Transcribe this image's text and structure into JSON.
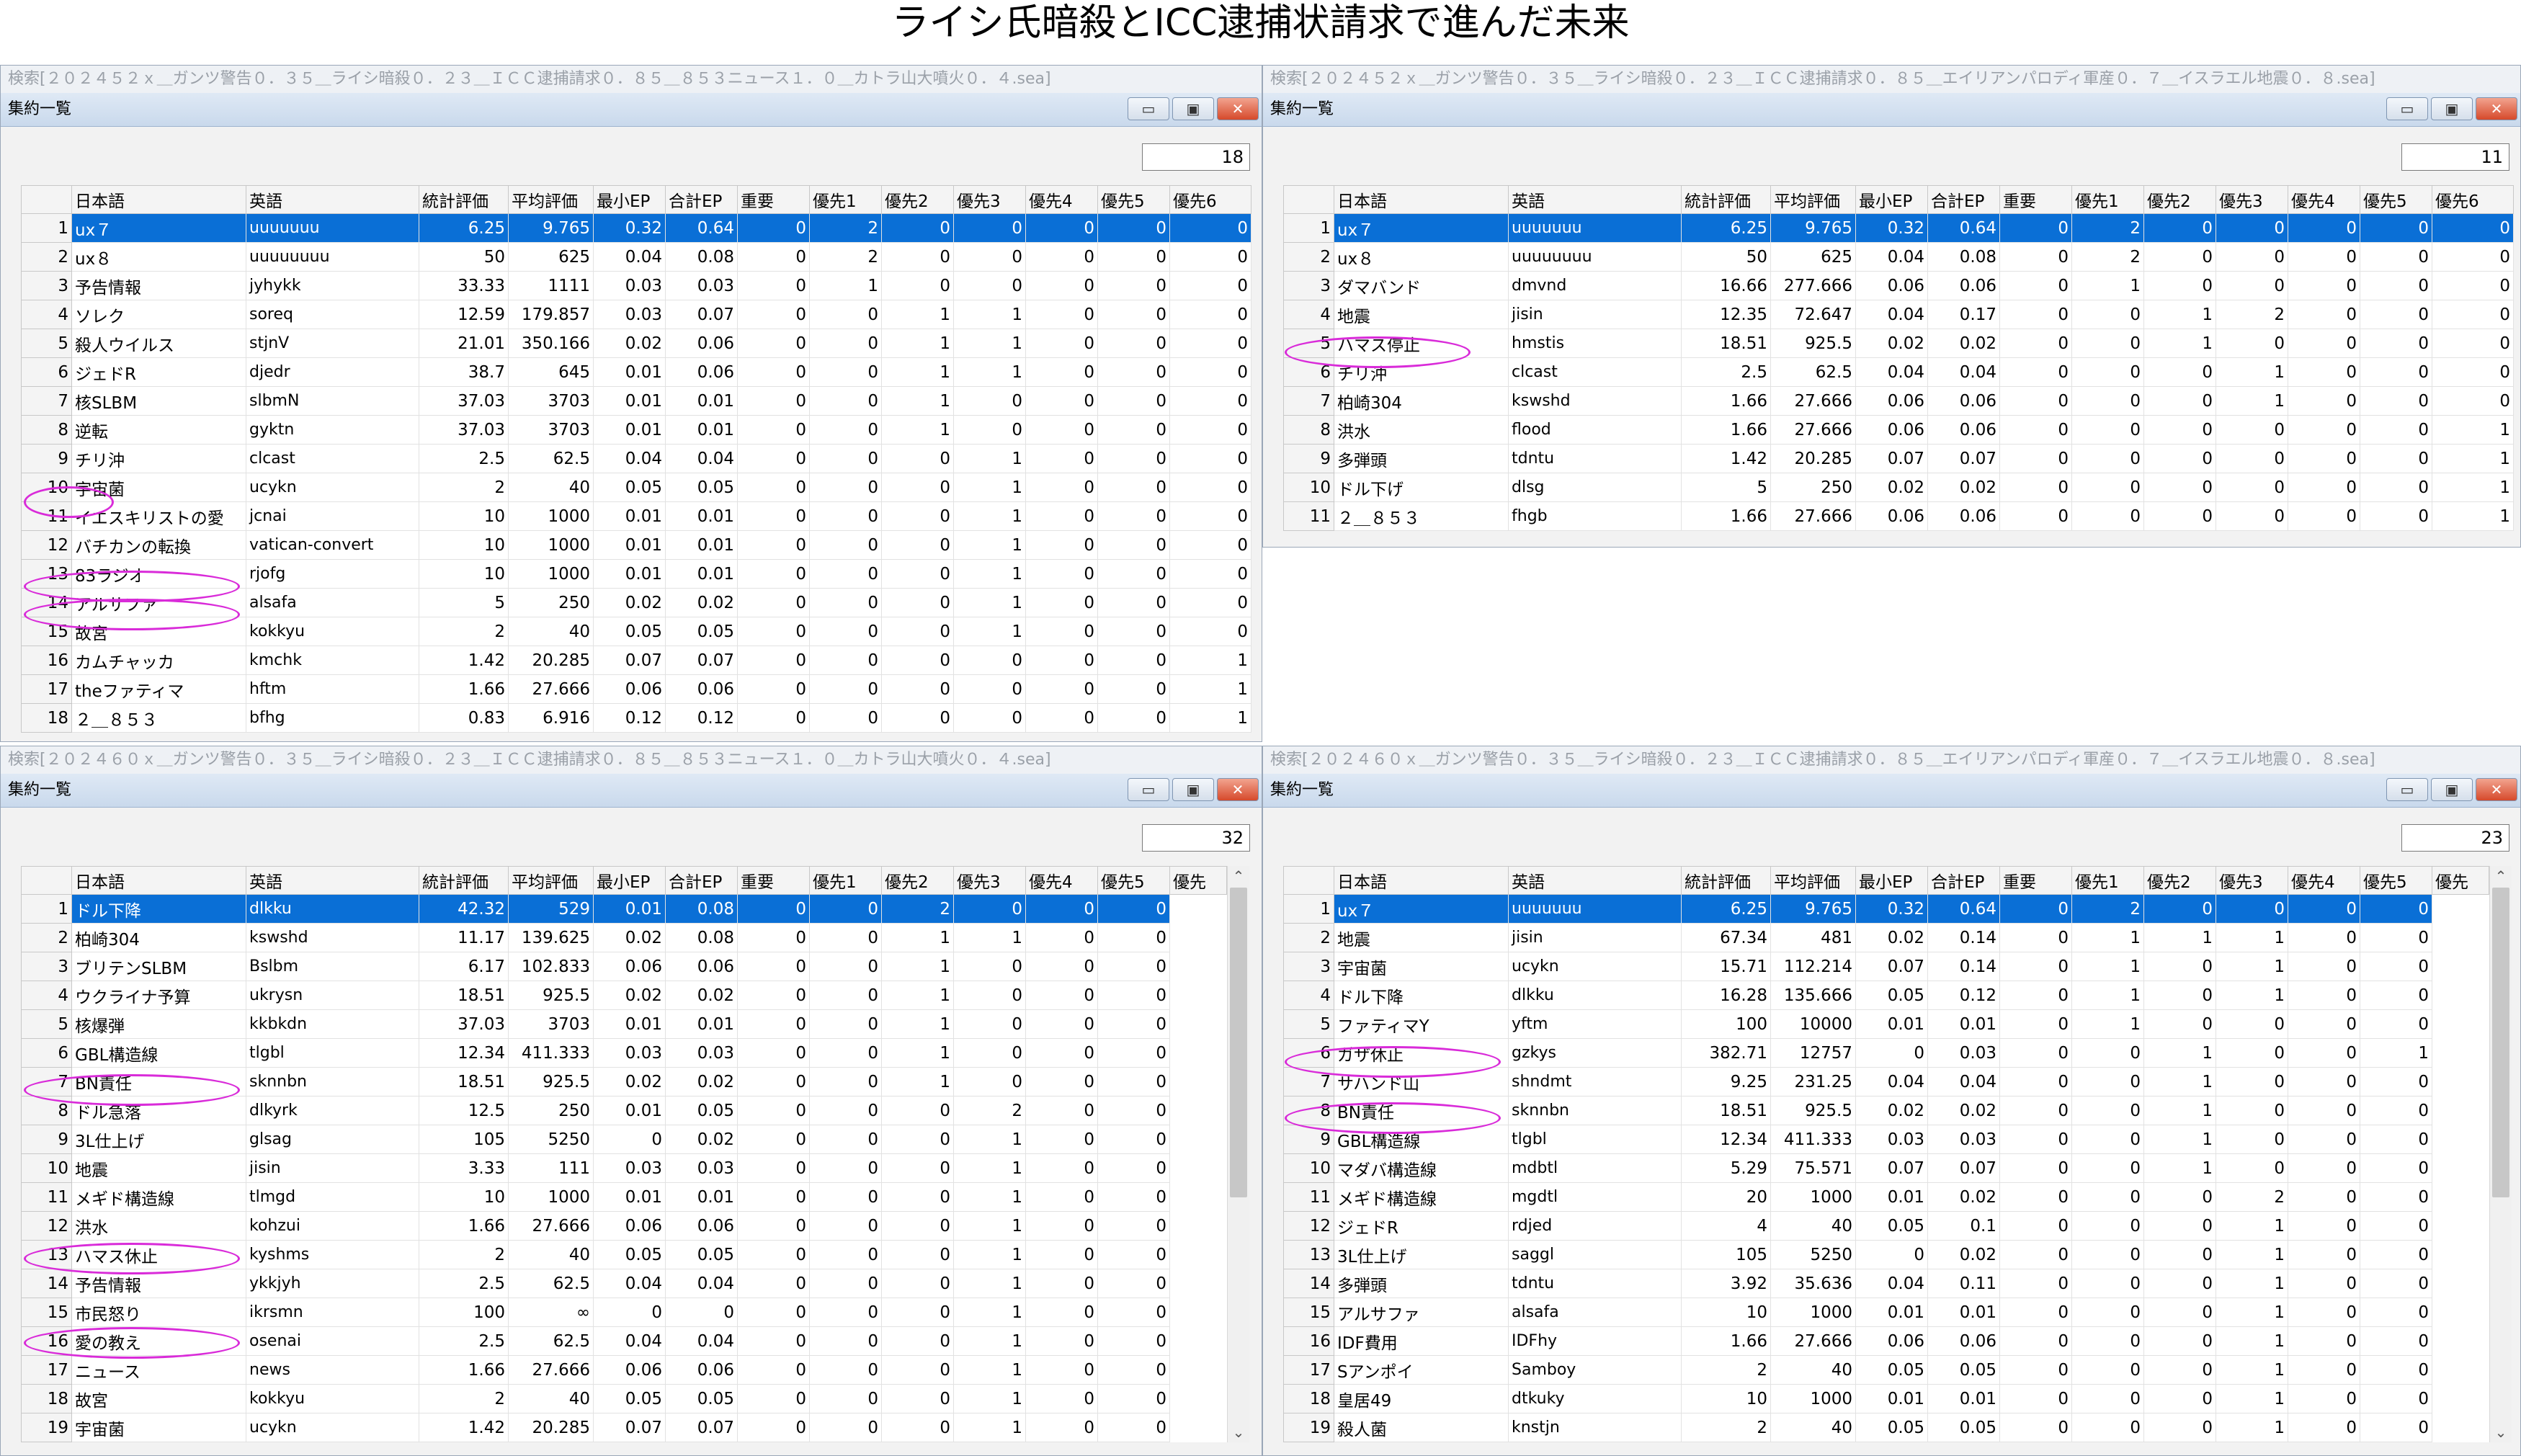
{
  "title": "ライシ氏暗殺とICC逮捕状請求で進んだ未来",
  "panels": [
    {
      "search": "検索[２０２４５２ｘ＿ガンツ警告０．３５＿ライシ暗殺０．２３＿ＩＣＣ逮捕請求０．８５＿８５３ニュース１．０＿カトラ山大噴火０．４.sea]",
      "window_title": "集約一覧",
      "count": "18",
      "headers": [
        "日本語",
        "英語",
        "統計評価",
        "平均評価",
        "最小EP",
        "合計EP",
        "重要",
        "優先1",
        "優先2",
        "優先3",
        "優先4",
        "優先5",
        "優先6"
      ],
      "rows": [
        [
          "1",
          "ux７",
          "uuuuuuu",
          "6.25",
          "9.765",
          "0.32",
          "0.64",
          "0",
          "2",
          "0",
          "0",
          "0",
          "0",
          "0"
        ],
        [
          "2",
          "ux８",
          "uuuuuuuu",
          "50",
          "625",
          "0.04",
          "0.08",
          "0",
          "2",
          "0",
          "0",
          "0",
          "0",
          "0"
        ],
        [
          "3",
          "予告情報",
          "jyhykk",
          "33.33",
          "1111",
          "0.03",
          "0.03",
          "0",
          "1",
          "0",
          "0",
          "0",
          "0",
          "0"
        ],
        [
          "4",
          "ソレク",
          "soreq",
          "12.59",
          "179.857",
          "0.03",
          "0.07",
          "0",
          "0",
          "1",
          "1",
          "0",
          "0",
          "0"
        ],
        [
          "5",
          "殺人ウイルス",
          "stjnV",
          "21.01",
          "350.166",
          "0.02",
          "0.06",
          "0",
          "0",
          "1",
          "1",
          "0",
          "0",
          "0"
        ],
        [
          "6",
          "ジェドR",
          "djedr",
          "38.7",
          "645",
          "0.01",
          "0.06",
          "0",
          "0",
          "1",
          "1",
          "0",
          "0",
          "0"
        ],
        [
          "7",
          "核SLBM",
          "slbmN",
          "37.03",
          "3703",
          "0.01",
          "0.01",
          "0",
          "0",
          "1",
          "0",
          "0",
          "0",
          "0"
        ],
        [
          "8",
          "逆転",
          "gyktn",
          "37.03",
          "3703",
          "0.01",
          "0.01",
          "0",
          "0",
          "1",
          "0",
          "0",
          "0",
          "0"
        ],
        [
          "9",
          "チリ沖",
          "clcast",
          "2.5",
          "62.5",
          "0.04",
          "0.04",
          "0",
          "0",
          "0",
          "1",
          "0",
          "0",
          "0"
        ],
        [
          "10",
          "宇宙菌",
          "ucykn",
          "2",
          "40",
          "0.05",
          "0.05",
          "0",
          "0",
          "0",
          "1",
          "0",
          "0",
          "0"
        ],
        [
          "11",
          "イエスキリストの愛",
          "jcnai",
          "10",
          "1000",
          "0.01",
          "0.01",
          "0",
          "0",
          "0",
          "1",
          "0",
          "0",
          "0"
        ],
        [
          "12",
          "バチカンの転換",
          "vatican-convert",
          "10",
          "1000",
          "0.01",
          "0.01",
          "0",
          "0",
          "0",
          "1",
          "0",
          "0",
          "0"
        ],
        [
          "13",
          "83ラジオ",
          "rjofg",
          "10",
          "1000",
          "0.01",
          "0.01",
          "0",
          "0",
          "0",
          "1",
          "0",
          "0",
          "0"
        ],
        [
          "14",
          "アルサファ",
          "alsafa",
          "5",
          "250",
          "0.02",
          "0.02",
          "0",
          "0",
          "0",
          "1",
          "0",
          "0",
          "0"
        ],
        [
          "15",
          "故宮",
          "kokkyu",
          "2",
          "40",
          "0.05",
          "0.05",
          "0",
          "0",
          "0",
          "1",
          "0",
          "0",
          "0"
        ],
        [
          "16",
          "カムチャッカ",
          "kmchk",
          "1.42",
          "20.285",
          "0.07",
          "0.07",
          "0",
          "0",
          "0",
          "0",
          "0",
          "0",
          "1"
        ],
        [
          "17",
          "theファティマ",
          "hftm",
          "1.66",
          "27.666",
          "0.06",
          "0.06",
          "0",
          "0",
          "0",
          "0",
          "0",
          "0",
          "1"
        ],
        [
          "18",
          "２＿８５３",
          "bfhg",
          "0.83",
          "6.916",
          "0.12",
          "0.12",
          "0",
          "0",
          "0",
          "0",
          "0",
          "0",
          "1"
        ]
      ]
    },
    {
      "search": "検索[２０２４５２ｘ＿ガンツ警告０．３５＿ライシ暗殺０．２３＿ＩＣＣ逮捕請求０．８５＿エイリアンパロディ軍産０．７＿イスラエル地震０．８.sea]",
      "window_title": "集約一覧",
      "count": "11",
      "headers": [
        "日本語",
        "英語",
        "統計評価",
        "平均評価",
        "最小EP",
        "合計EP",
        "重要",
        "優先1",
        "優先2",
        "優先3",
        "優先4",
        "優先5",
        "優先6"
      ],
      "rows": [
        [
          "1",
          "ux７",
          "uuuuuuu",
          "6.25",
          "9.765",
          "0.32",
          "0.64",
          "0",
          "2",
          "0",
          "0",
          "0",
          "0",
          "0"
        ],
        [
          "2",
          "ux８",
          "uuuuuuuu",
          "50",
          "625",
          "0.04",
          "0.08",
          "0",
          "2",
          "0",
          "0",
          "0",
          "0",
          "0"
        ],
        [
          "3",
          "ダマバンド",
          "dmvnd",
          "16.66",
          "277.666",
          "0.06",
          "0.06",
          "0",
          "1",
          "0",
          "0",
          "0",
          "0",
          "0"
        ],
        [
          "4",
          "地震",
          "jisin",
          "12.35",
          "72.647",
          "0.04",
          "0.17",
          "0",
          "0",
          "1",
          "2",
          "0",
          "0",
          "0"
        ],
        [
          "5",
          "ハマス停止",
          "hmstis",
          "18.51",
          "925.5",
          "0.02",
          "0.02",
          "0",
          "0",
          "1",
          "0",
          "0",
          "0",
          "0"
        ],
        [
          "6",
          "チリ沖",
          "clcast",
          "2.5",
          "62.5",
          "0.04",
          "0.04",
          "0",
          "0",
          "0",
          "1",
          "0",
          "0",
          "0"
        ],
        [
          "7",
          "柏崎304",
          "kswshd",
          "1.66",
          "27.666",
          "0.06",
          "0.06",
          "0",
          "0",
          "0",
          "1",
          "0",
          "0",
          "0"
        ],
        [
          "8",
          "洪水",
          "flood",
          "1.66",
          "27.666",
          "0.06",
          "0.06",
          "0",
          "0",
          "0",
          "0",
          "0",
          "0",
          "1"
        ],
        [
          "9",
          "多弾頭",
          "tdntu",
          "1.42",
          "20.285",
          "0.07",
          "0.07",
          "0",
          "0",
          "0",
          "0",
          "0",
          "0",
          "1"
        ],
        [
          "10",
          "ドル下げ",
          "dlsg",
          "5",
          "250",
          "0.02",
          "0.02",
          "0",
          "0",
          "0",
          "0",
          "0",
          "0",
          "1"
        ],
        [
          "11",
          "２＿８５３",
          "fhgb",
          "1.66",
          "27.666",
          "0.06",
          "0.06",
          "0",
          "0",
          "0",
          "0",
          "0",
          "0",
          "1"
        ]
      ]
    },
    {
      "search": "検索[２０２４６０ｘ＿ガンツ警告０．３５＿ライシ暗殺０．２３＿ＩＣＣ逮捕請求０．８５＿８５３ニュース１．０＿カトラ山大噴火０．４.sea]",
      "window_title": "集約一覧",
      "count": "32",
      "headers": [
        "日本語",
        "英語",
        "統計評価",
        "平均評価",
        "最小EP",
        "合計EP",
        "重要",
        "優先1",
        "優先2",
        "優先3",
        "優先4",
        "優先5",
        "優先"
      ],
      "rows": [
        [
          "1",
          "ドル下降",
          "dlkku",
          "42.32",
          "529",
          "0.01",
          "0.08",
          "0",
          "0",
          "2",
          "0",
          "0",
          "0"
        ],
        [
          "2",
          "柏崎304",
          "kswshd",
          "11.17",
          "139.625",
          "0.02",
          "0.08",
          "0",
          "0",
          "1",
          "1",
          "0",
          "0"
        ],
        [
          "3",
          "ブリテンSLBM",
          "Bslbm",
          "6.17",
          "102.833",
          "0.06",
          "0.06",
          "0",
          "0",
          "1",
          "0",
          "0",
          "0"
        ],
        [
          "4",
          "ウクライナ予算",
          "ukrysn",
          "18.51",
          "925.5",
          "0.02",
          "0.02",
          "0",
          "0",
          "1",
          "0",
          "0",
          "0"
        ],
        [
          "5",
          "核爆弾",
          "kkbkdn",
          "37.03",
          "3703",
          "0.01",
          "0.01",
          "0",
          "0",
          "1",
          "0",
          "0",
          "0"
        ],
        [
          "6",
          "GBL構造線",
          "tlgbl",
          "12.34",
          "411.333",
          "0.03",
          "0.03",
          "0",
          "0",
          "1",
          "0",
          "0",
          "0"
        ],
        [
          "7",
          "BN責任",
          "sknnbn",
          "18.51",
          "925.5",
          "0.02",
          "0.02",
          "0",
          "0",
          "1",
          "0",
          "0",
          "0"
        ],
        [
          "8",
          "ドル急落",
          "dlkyrk",
          "12.5",
          "250",
          "0.01",
          "0.05",
          "0",
          "0",
          "0",
          "2",
          "0",
          "0"
        ],
        [
          "9",
          "3L仕上げ",
          "glsag",
          "105",
          "5250",
          "0",
          "0.02",
          "0",
          "0",
          "0",
          "1",
          "0",
          "0"
        ],
        [
          "10",
          "地震",
          "jisin",
          "3.33",
          "111",
          "0.03",
          "0.03",
          "0",
          "0",
          "0",
          "1",
          "0",
          "0"
        ],
        [
          "11",
          "メギド構造線",
          "tlmgd",
          "10",
          "1000",
          "0.01",
          "0.01",
          "0",
          "0",
          "0",
          "1",
          "0",
          "0"
        ],
        [
          "12",
          "洪水",
          "kohzui",
          "1.66",
          "27.666",
          "0.06",
          "0.06",
          "0",
          "0",
          "0",
          "1",
          "0",
          "0"
        ],
        [
          "13",
          "ハマス休止",
          "kyshms",
          "2",
          "40",
          "0.05",
          "0.05",
          "0",
          "0",
          "0",
          "1",
          "0",
          "0"
        ],
        [
          "14",
          "予告情報",
          "ykkjyh",
          "2.5",
          "62.5",
          "0.04",
          "0.04",
          "0",
          "0",
          "0",
          "1",
          "0",
          "0"
        ],
        [
          "15",
          "市民怒り",
          "ikrsmn",
          "100",
          "∞",
          "0",
          "0",
          "0",
          "0",
          "0",
          "1",
          "0",
          "0"
        ],
        [
          "16",
          "愛の教え",
          "osenai",
          "2.5",
          "62.5",
          "0.04",
          "0.04",
          "0",
          "0",
          "0",
          "1",
          "0",
          "0"
        ],
        [
          "17",
          "ニュース",
          "news",
          "1.66",
          "27.666",
          "0.06",
          "0.06",
          "0",
          "0",
          "0",
          "1",
          "0",
          "0"
        ],
        [
          "18",
          "故宮",
          "kokkyu",
          "2",
          "40",
          "0.05",
          "0.05",
          "0",
          "0",
          "0",
          "1",
          "0",
          "0"
        ],
        [
          "19",
          "宇宙菌",
          "ucykn",
          "1.42",
          "20.285",
          "0.07",
          "0.07",
          "0",
          "0",
          "0",
          "1",
          "0",
          "0"
        ]
      ]
    },
    {
      "search": "検索[２０２４６０ｘ＿ガンツ警告０．３５＿ライシ暗殺０．２３＿ＩＣＣ逮捕請求０．８５＿エイリアンパロディ軍産０．７＿イスラエル地震０．８.sea]",
      "window_title": "集約一覧",
      "count": "23",
      "headers": [
        "日本語",
        "英語",
        "統計評価",
        "平均評価",
        "最小EP",
        "合計EP",
        "重要",
        "優先1",
        "優先2",
        "優先3",
        "優先4",
        "優先5",
        "優先"
      ],
      "rows": [
        [
          "1",
          "ux７",
          "uuuuuuu",
          "6.25",
          "9.765",
          "0.32",
          "0.64",
          "0",
          "2",
          "0",
          "0",
          "0",
          "0"
        ],
        [
          "2",
          "地震",
          "jisin",
          "67.34",
          "481",
          "0.02",
          "0.14",
          "0",
          "1",
          "1",
          "1",
          "0",
          "0"
        ],
        [
          "3",
          "宇宙菌",
          "ucykn",
          "15.71",
          "112.214",
          "0.07",
          "0.14",
          "0",
          "1",
          "0",
          "1",
          "0",
          "0"
        ],
        [
          "4",
          "ドル下降",
          "dlkku",
          "16.28",
          "135.666",
          "0.05",
          "0.12",
          "0",
          "1",
          "0",
          "1",
          "0",
          "0"
        ],
        [
          "5",
          "ファティマY",
          "yftm",
          "100",
          "10000",
          "0.01",
          "0.01",
          "0",
          "1",
          "0",
          "0",
          "0",
          "0"
        ],
        [
          "6",
          "ガザ休止",
          "gzkys",
          "382.71",
          "12757",
          "0",
          "0.03",
          "0",
          "0",
          "1",
          "0",
          "0",
          "1"
        ],
        [
          "7",
          "サハンド山",
          "shndmt",
          "9.25",
          "231.25",
          "0.04",
          "0.04",
          "0",
          "0",
          "1",
          "0",
          "0",
          "0"
        ],
        [
          "8",
          "BN責任",
          "sknnbn",
          "18.51",
          "925.5",
          "0.02",
          "0.02",
          "0",
          "0",
          "1",
          "0",
          "0",
          "0"
        ],
        [
          "9",
          "GBL構造線",
          "tlgbl",
          "12.34",
          "411.333",
          "0.03",
          "0.03",
          "0",
          "0",
          "1",
          "0",
          "0",
          "0"
        ],
        [
          "10",
          "マダバ構造線",
          "mdbtl",
          "5.29",
          "75.571",
          "0.07",
          "0.07",
          "0",
          "0",
          "1",
          "0",
          "0",
          "0"
        ],
        [
          "11",
          "メギド構造線",
          "mgdtl",
          "20",
          "1000",
          "0.01",
          "0.02",
          "0",
          "0",
          "0",
          "2",
          "0",
          "0"
        ],
        [
          "12",
          "ジェドR",
          "rdjed",
          "4",
          "40",
          "0.05",
          "0.1",
          "0",
          "0",
          "0",
          "1",
          "0",
          "0"
        ],
        [
          "13",
          "3L仕上げ",
          "saggl",
          "105",
          "5250",
          "0",
          "0.02",
          "0",
          "0",
          "0",
          "1",
          "0",
          "0"
        ],
        [
          "14",
          "多弾頭",
          "tdntu",
          "3.92",
          "35.636",
          "0.04",
          "0.11",
          "0",
          "0",
          "0",
          "1",
          "0",
          "0"
        ],
        [
          "15",
          "アルサファ",
          "alsafa",
          "10",
          "1000",
          "0.01",
          "0.01",
          "0",
          "0",
          "0",
          "1",
          "0",
          "0"
        ],
        [
          "16",
          "IDF費用",
          "IDFhy",
          "1.66",
          "27.666",
          "0.06",
          "0.06",
          "0",
          "0",
          "0",
          "1",
          "0",
          "0"
        ],
        [
          "17",
          "Sアンポイ",
          "Samboy",
          "2",
          "40",
          "0.05",
          "0.05",
          "0",
          "0",
          "0",
          "1",
          "0",
          "0"
        ],
        [
          "18",
          "皇居49",
          "dtkuky",
          "10",
          "1000",
          "0.01",
          "0.01",
          "0",
          "0",
          "0",
          "1",
          "0",
          "0"
        ],
        [
          "19",
          "殺人菌",
          "knstjn",
          "2",
          "40",
          "0.05",
          "0.05",
          "0",
          "0",
          "0",
          "1",
          "0",
          "0"
        ]
      ]
    }
  ]
}
